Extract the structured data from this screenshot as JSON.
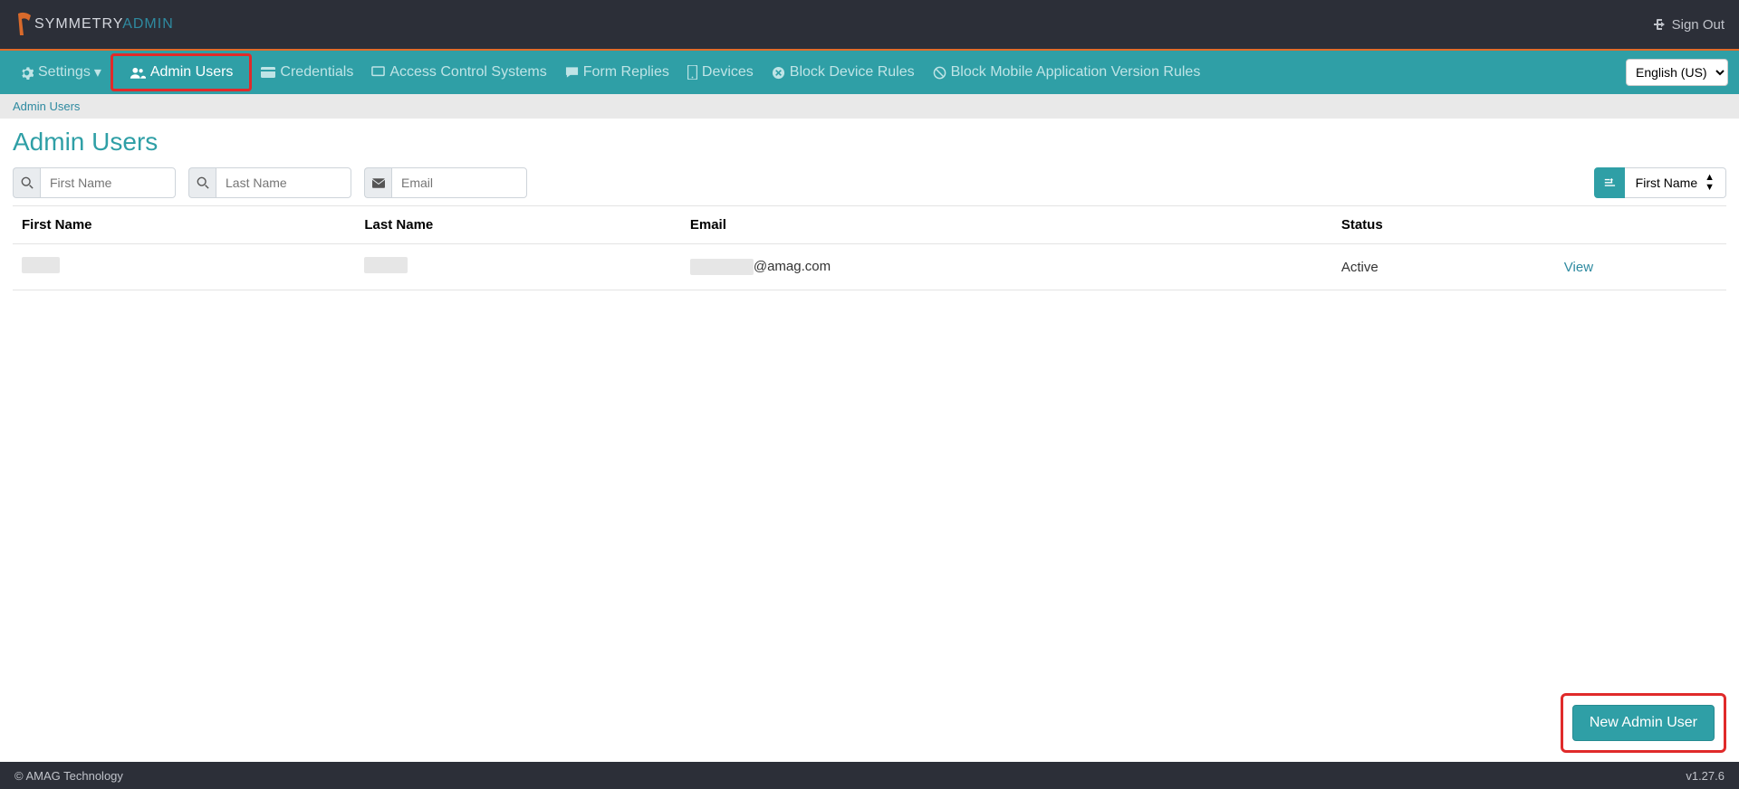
{
  "header": {
    "logo_part1": "SYMMETRY",
    "logo_part2": "ADMIN",
    "signout": "Sign Out"
  },
  "nav": {
    "settings": "Settings",
    "admin_users": "Admin Users",
    "credentials": "Credentials",
    "access_control": "Access Control Systems",
    "form_replies": "Form Replies",
    "devices": "Devices",
    "block_device": "Block Device Rules",
    "block_mobile": "Block Mobile Application Version Rules",
    "language": "English (US)"
  },
  "breadcrumb": "Admin Users",
  "page_title": "Admin Users",
  "filters": {
    "first_name_ph": "First Name",
    "last_name_ph": "Last Name",
    "email_ph": "Email",
    "sort_field": "First Name"
  },
  "table": {
    "col_first": "First Name",
    "col_last": "Last Name",
    "col_email": "Email",
    "col_status": "Status",
    "rows": [
      {
        "email_suffix": "@amag.com",
        "status": "Active",
        "action": "View"
      }
    ]
  },
  "new_button": "New Admin User",
  "footer": {
    "copyright": "© AMAG Technology",
    "version": "v1.27.6"
  }
}
